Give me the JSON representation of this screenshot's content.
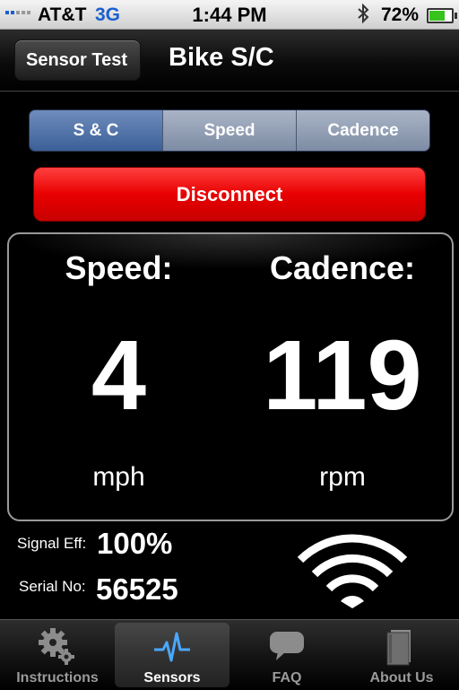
{
  "status_bar": {
    "carrier": "AT&T",
    "network": "3G",
    "time": "1:44 PM",
    "battery_percent": "72%",
    "battery_level": 0.72,
    "icons": [
      "signal-icon",
      "bluetooth-icon",
      "battery-icon"
    ]
  },
  "nav": {
    "back_label": "Sensor Test",
    "title": "Bike S/C"
  },
  "segments": [
    {
      "label": "S & C",
      "selected": true
    },
    {
      "label": "Speed",
      "selected": false
    },
    {
      "label": "Cadence",
      "selected": false
    }
  ],
  "disconnect_label": "Disconnect",
  "speed": {
    "label": "Speed:",
    "value": "4",
    "unit": "mph"
  },
  "cadence": {
    "label": "Cadence:",
    "value": "119",
    "unit": "rpm"
  },
  "signal": {
    "label": "Signal Eff:",
    "value": "100%"
  },
  "serial": {
    "label": "Serial No:",
    "value": "56525"
  },
  "tabs": [
    {
      "label": "Instructions",
      "icon": "gears-icon",
      "active": false
    },
    {
      "label": "Sensors",
      "icon": "pulse-icon",
      "active": true
    },
    {
      "label": "FAQ",
      "icon": "speech-bubble-icon",
      "active": false
    },
    {
      "label": "About Us",
      "icon": "book-icon",
      "active": false
    }
  ],
  "colors": {
    "network": "#1a5fd0",
    "disconnect": "#e90000",
    "segment_active": "#3b5f98",
    "sensors_icon": "#4aa8ff"
  }
}
